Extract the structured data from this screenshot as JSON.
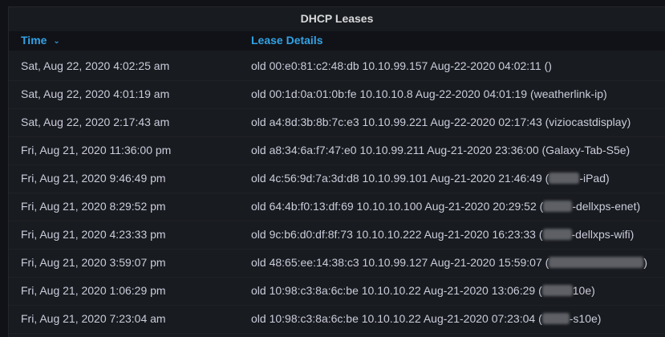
{
  "panel": {
    "title": "DHCP Leases"
  },
  "table": {
    "columns": {
      "time": "Time",
      "details": "Lease Details"
    },
    "sort": {
      "column": "time",
      "direction": "desc",
      "icon": "chevron-down-icon"
    },
    "rows": [
      {
        "time": "Sat, Aug 22, 2020 4:02:25 am",
        "details": "old 00:e0:81:c2:48:db 10.10.99.157 Aug-22-2020 04:02:11 ()"
      },
      {
        "time": "Sat, Aug 22, 2020 4:01:19 am",
        "details": "old 00:1d:0a:01:0b:fe 10.10.10.8 Aug-22-2020 04:01:19 (weatherlink-ip)"
      },
      {
        "time": "Sat, Aug 22, 2020 2:17:43 am",
        "details": "old a4:8d:3b:8b:7c:e3 10.10.99.221 Aug-22-2020 02:17:43 (viziocastdisplay)"
      },
      {
        "time": "Fri, Aug 21, 2020 11:36:00 pm",
        "details": "old a8:34:6a:f7:47:e0 10.10.99.211 Aug-21-2020 23:36:00 (Galaxy-Tab-S5e)"
      },
      {
        "time": "Fri, Aug 21, 2020 9:46:49 pm",
        "details_prefix": "old 4c:56:9d:7a:3d:d8 10.10.99.101 Aug-21-2020 21:46:49 (",
        "details_suffix": "-iPad)"
      },
      {
        "time": "Fri, Aug 21, 2020 8:29:52 pm",
        "details_prefix": "old 64:4b:f0:13:df:69 10.10.10.100 Aug-21-2020 20:29:52 (",
        "details_suffix": "-dellxps-enet)"
      },
      {
        "time": "Fri, Aug 21, 2020 4:23:33 pm",
        "details_prefix": "old 9c:b6:d0:df:8f:73 10.10.10.222 Aug-21-2020 16:23:33 (",
        "details_suffix": "-dellxps-wifi)"
      },
      {
        "time": "Fri, Aug 21, 2020 3:59:07 pm",
        "details_prefix": "old 48:65:ee:14:38:c3 10.10.99.127 Aug-21-2020 15:59:07 (",
        "details_suffix": ")"
      },
      {
        "time": "Fri, Aug 21, 2020 1:06:29 pm",
        "details_prefix": "old 10:98:c3:8a:6c:be 10.10.10.22 Aug-21-2020 13:06:29 (",
        "details_suffix": "10e)"
      },
      {
        "time": "Fri, Aug 21, 2020 7:23:04 am",
        "details_prefix": "old 10:98:c3:8a:6c:be 10.10.10.22 Aug-21-2020 07:23:04 (",
        "details_suffix": "-s10e)"
      }
    ]
  }
}
